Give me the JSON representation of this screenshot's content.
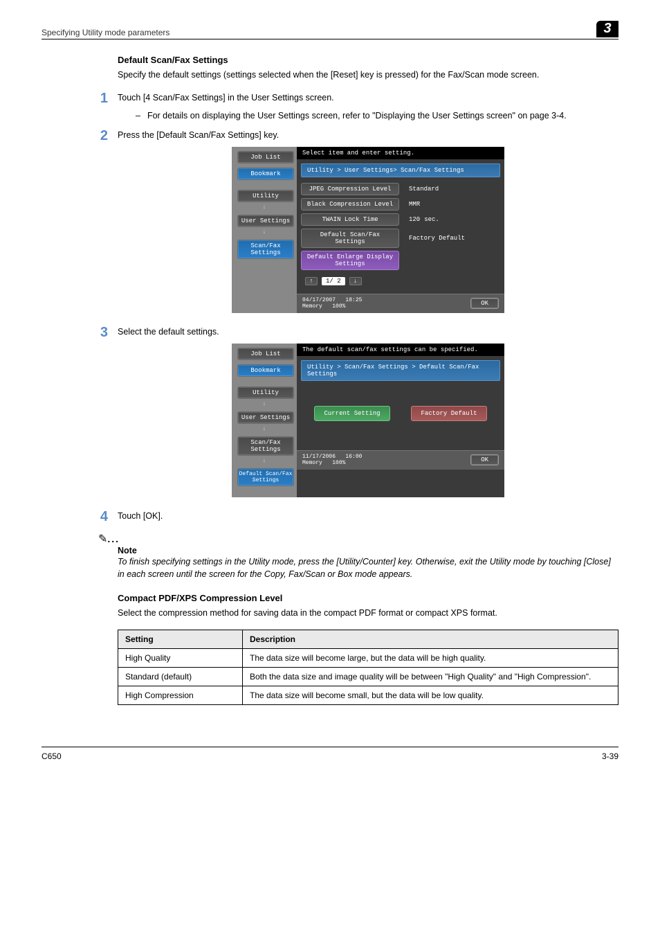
{
  "header": {
    "title": "Specifying Utility mode parameters",
    "chapter": "3"
  },
  "section1_title": "Default Scan/Fax Settings",
  "section1_intro": "Specify the default settings (settings selected when the [Reset] key is pressed) for the Fax/Scan mode screen.",
  "steps": {
    "s1_text": "Touch [4 Scan/Fax Settings] in the User Settings screen.",
    "s1_sub": "For details on displaying the User Settings screen, refer to \"Displaying the User Settings screen\" on page 3-4.",
    "s2_text": "Press the [Default Scan/Fax Settings] key.",
    "s3_text": "Select the default settings.",
    "s4_text": "Touch [OK]."
  },
  "panel1": {
    "tabs": {
      "job": "Job List",
      "bookmark": "Bookmark",
      "utility": "Utility",
      "user": "User Settings",
      "scanfax": "Scan/Fax Settings"
    },
    "top": "Select item and enter setting.",
    "crumb": "Utility > User Settings> Scan/Fax Settings",
    "rows": {
      "r1l": "JPEG Compression Level",
      "r1v": "Standard",
      "r2l": "Black Compression Level",
      "r2v": "MMR",
      "r3l": "TWAIN Lock Time",
      "r3v": "120",
      "r3u": "sec.",
      "r4l": "Default Scan/Fax Settings",
      "r4v": "Factory Default",
      "r5l": "Default Enlarge Display Settings"
    },
    "page": "1/ 2",
    "date": "04/17/2007",
    "time": "18:25",
    "meml": "Memory",
    "memv": "100%",
    "ok": "OK"
  },
  "panel2": {
    "tabs": {
      "job": "Job List",
      "bookmark": "Bookmark",
      "utility": "Utility",
      "user": "User Settings",
      "scanfax": "Scan/Fax Settings",
      "def": "Default Scan/Fax Settings"
    },
    "top": "The default scan/fax settings can be specified.",
    "crumb": "Utility > Scan/Fax Settings > Default Scan/Fax Settings",
    "current": "Current Setting",
    "factory": "Factory Default",
    "date": "11/17/2006",
    "time": "16:00",
    "meml": "Memory",
    "memv": "100%",
    "ok": "OK"
  },
  "note": {
    "label": "Note",
    "text": "To finish specifying settings in the Utility mode, press the [Utility/Counter] key. Otherwise, exit the Utility mode by touching [Close] in each screen until the screen for the Copy, Fax/Scan or Box mode appears."
  },
  "section2_title": "Compact PDF/XPS Compression Level",
  "section2_intro": "Select the compression method for saving data in the compact PDF format or compact XPS format.",
  "table": {
    "h1": "Setting",
    "h2": "Description",
    "r1c1": "High Quality",
    "r1c2": "The data size will become large, but the data will be high quality.",
    "r2c1": "Standard (default)",
    "r2c2": "Both the data size and image quality will be between \"High Quality\" and \"High Compression\".",
    "r3c1": "High Compression",
    "r3c2": "The data size will become small, but the data will be low quality."
  },
  "footer": {
    "model": "C650",
    "page": "3-39"
  }
}
